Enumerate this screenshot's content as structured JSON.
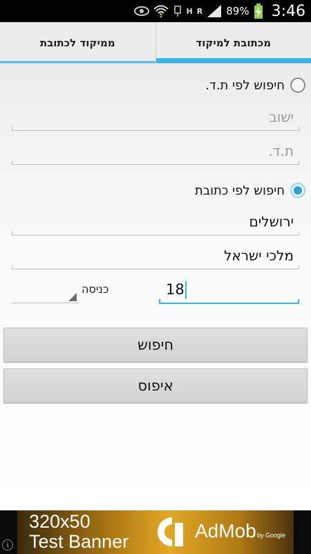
{
  "status_bar": {
    "time": "3:46",
    "battery_percent": "89%",
    "network_h": "H",
    "network_r": "R",
    "icons": [
      "eye-icon",
      "wifi-icon",
      "usb-icon",
      "signal-icon",
      "battery-charging-icon"
    ]
  },
  "tabs": [
    {
      "label": "ממיקוד לכתובת",
      "active": false
    },
    {
      "label": "מכתובת למיקוד",
      "active": true
    }
  ],
  "form": {
    "radio_po_box": {
      "label": "חיפוש לפי ת.ד.",
      "checked": false
    },
    "po_box_city": {
      "value": "",
      "placeholder": "ישוב"
    },
    "po_box_number": {
      "value": "",
      "placeholder": "ת.ד."
    },
    "radio_address": {
      "label": "חיפוש לפי כתובת",
      "checked": true
    },
    "city": {
      "value": "ירושלים"
    },
    "street": {
      "value": "מלכי ישראל"
    },
    "house_number": {
      "value": "18"
    },
    "entrance": {
      "label": "כניסה",
      "value": ""
    }
  },
  "buttons": {
    "search": "חיפוש",
    "reset": "איפוס"
  },
  "ad": {
    "size_text": "320x50",
    "test_text": "Test Banner",
    "brand": "AdMob",
    "by": "by Google",
    "info": "i"
  },
  "colors": {
    "accent": "#33b5e5",
    "status_bar": "#000000",
    "button": "#d8d8d8"
  }
}
